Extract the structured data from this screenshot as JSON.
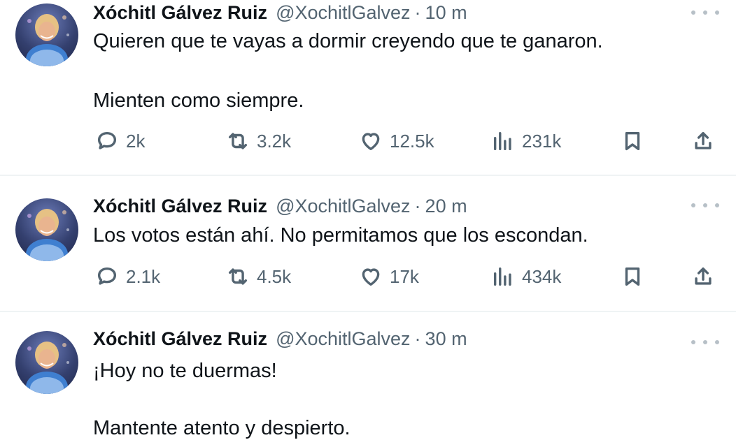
{
  "tweets": [
    {
      "name": "Xóchitl Gálvez Ruiz",
      "handle": "@XochitlGalvez",
      "separator": "·",
      "time": "10 m",
      "lines": [
        "Quieren que te vayas a dormir creyendo que te ganaron.",
        "Mienten como siempre."
      ],
      "replies": "2k",
      "reposts": "3.2k",
      "likes": "12.5k",
      "views": "231k"
    },
    {
      "name": "Xóchitl Gálvez Ruiz",
      "handle": "@XochitlGalvez",
      "separator": "·",
      "time": "20 m",
      "lines": [
        "Los votos están ahí. No permitamos que los escondan."
      ],
      "replies": "2.1k",
      "reposts": "4.5k",
      "likes": "17k",
      "views": "434k"
    },
    {
      "name": "Xóchitl Gálvez Ruiz",
      "handle": "@XochitlGalvez",
      "separator": "·",
      "time": "30 m",
      "lines": [
        "¡Hoy no te duermas!",
        "Mantente atento y despierto."
      ]
    }
  ],
  "icons": {
    "reply": "speech-bubble-icon",
    "repost": "repost-arrows-icon",
    "like": "heart-icon",
    "views": "bar-chart-icon",
    "bookmark": "bookmark-icon",
    "share": "share-upload-icon",
    "more": "more-dots-icon"
  },
  "colors": {
    "text": "#0f1419",
    "secondary": "#536471",
    "divider": "#eff3f4"
  }
}
